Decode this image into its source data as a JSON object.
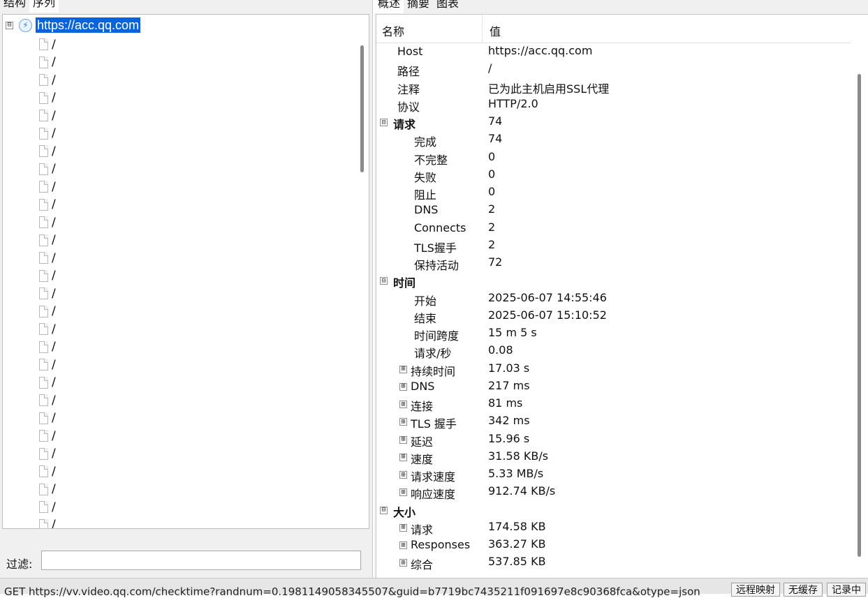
{
  "left": {
    "tabs": [
      "结构",
      "序列"
    ],
    "tree": {
      "root": {
        "label": "https://acc.qq.com",
        "expander": "⊟",
        "icon": "lightning-icon"
      },
      "children": [
        "/",
        "/",
        "/",
        "/",
        "/",
        "/",
        "/",
        "/",
        "/",
        "/",
        "/",
        "/",
        "/",
        "/",
        "/",
        "/",
        "/",
        "/",
        "/",
        "/",
        "/",
        "/",
        "/",
        "/",
        "/",
        "/",
        "/",
        "/"
      ]
    },
    "filter": {
      "label": "过滤:",
      "value": ""
    }
  },
  "right": {
    "tabs": [
      "概述",
      "摘要",
      "图表"
    ],
    "columns": {
      "name": "名称",
      "value": "值"
    },
    "rows": [
      {
        "level": 0,
        "name": "Host",
        "value": "https://acc.qq.com"
      },
      {
        "level": 0,
        "name": "路径",
        "value": "/"
      },
      {
        "level": 0,
        "name": "注释",
        "value": "已为此主机启用SSL代理"
      },
      {
        "level": 0,
        "name": "协议",
        "value": "HTTP/2.0"
      },
      {
        "level": 0,
        "name": "请求",
        "value": "74",
        "group": true,
        "expander": "⊟"
      },
      {
        "level": 1,
        "name": "完成",
        "value": "74"
      },
      {
        "level": 1,
        "name": "不完整",
        "value": "0"
      },
      {
        "level": 1,
        "name": "失败",
        "value": "0"
      },
      {
        "level": 1,
        "name": "阻止",
        "value": "0"
      },
      {
        "level": 1,
        "name": "DNS",
        "value": "2"
      },
      {
        "level": 1,
        "name": "Connects",
        "value": "2"
      },
      {
        "level": 1,
        "name": "TLS握手",
        "value": "2"
      },
      {
        "level": 1,
        "name": "保持活动",
        "value": "72"
      },
      {
        "level": 0,
        "name": "时间",
        "value": "",
        "group": true,
        "expander": "⊟"
      },
      {
        "level": 1,
        "name": "开始",
        "value": "2025-06-07 14:55:46"
      },
      {
        "level": 1,
        "name": "结束",
        "value": "2025-06-07 15:10:52"
      },
      {
        "level": 1,
        "name": "时间跨度",
        "value": "15 m 5 s"
      },
      {
        "level": 1,
        "name": "请求/秒",
        "value": "0.08"
      },
      {
        "level": 2,
        "name": "持续时间",
        "value": "17.03 s",
        "expander": "⊞"
      },
      {
        "level": 2,
        "name": "DNS",
        "value": "217 ms",
        "expander": "⊞"
      },
      {
        "level": 2,
        "name": "连接",
        "value": "81 ms",
        "expander": "⊞"
      },
      {
        "level": 2,
        "name": "TLS 握手",
        "value": "342 ms",
        "expander": "⊞"
      },
      {
        "level": 2,
        "name": "延迟",
        "value": "15.96 s",
        "expander": "⊞"
      },
      {
        "level": 2,
        "name": "速度",
        "value": "31.58 KB/s",
        "expander": "⊞"
      },
      {
        "level": 2,
        "name": "请求速度",
        "value": "5.33 MB/s",
        "expander": "⊞"
      },
      {
        "level": 2,
        "name": "响应速度",
        "value": "912.74 KB/s",
        "expander": "⊞"
      },
      {
        "level": 0,
        "name": "大小",
        "value": "",
        "group": true,
        "expander": "⊟"
      },
      {
        "level": 2,
        "name": "请求",
        "value": "174.58 KB",
        "expander": "⊞"
      },
      {
        "level": 2,
        "name": "Responses",
        "value": "363.27 KB",
        "expander": "⊞"
      },
      {
        "level": 2,
        "name": "综合",
        "value": "537.85 KB",
        "expander": "⊞"
      }
    ]
  },
  "statusbar": {
    "url": "GET https://vv.video.qq.com/checktime?randnum=0.1981149058345507&guid=b7719bc7435211f091697e8c90368fca&otype=json",
    "buttons": [
      "远程映射",
      "无缓存",
      "记录中"
    ]
  },
  "colors": {
    "selection": "#0a64d8",
    "panel_bg": "#f0f0f0"
  }
}
